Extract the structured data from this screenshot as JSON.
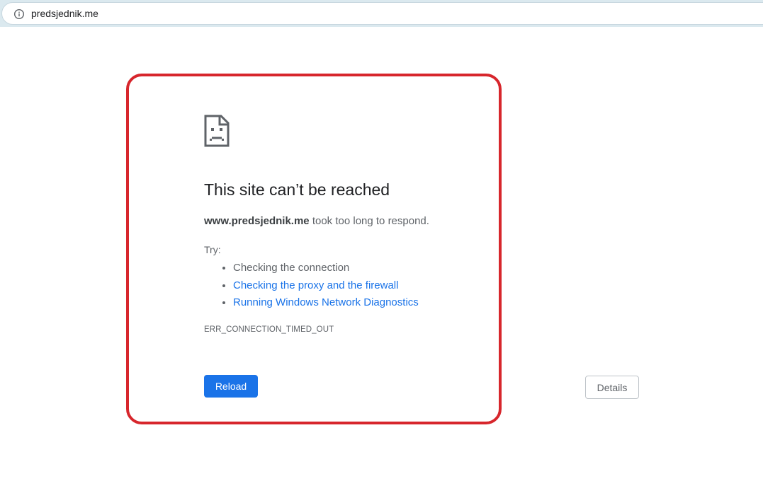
{
  "browser": {
    "url": "predsjednik.me",
    "info_icon": "info-icon"
  },
  "error_page": {
    "icon": "sad-page-icon",
    "title": "This site can’t be reached",
    "host": "www.predsjednik.me",
    "message_suffix": " took too long to respond.",
    "try_label": "Try:",
    "suggestions": [
      {
        "text": "Checking the connection",
        "is_link": false
      },
      {
        "text": "Checking the proxy and the firewall",
        "is_link": true
      },
      {
        "text": "Running Windows Network Diagnostics",
        "is_link": true
      }
    ],
    "error_code": "ERR_CONNECTION_TIMED_OUT",
    "reload_label": "Reload",
    "details_label": "Details"
  },
  "colors": {
    "highlight": "#d7262c",
    "link": "#1a73e8",
    "button": "#1a73e8"
  }
}
